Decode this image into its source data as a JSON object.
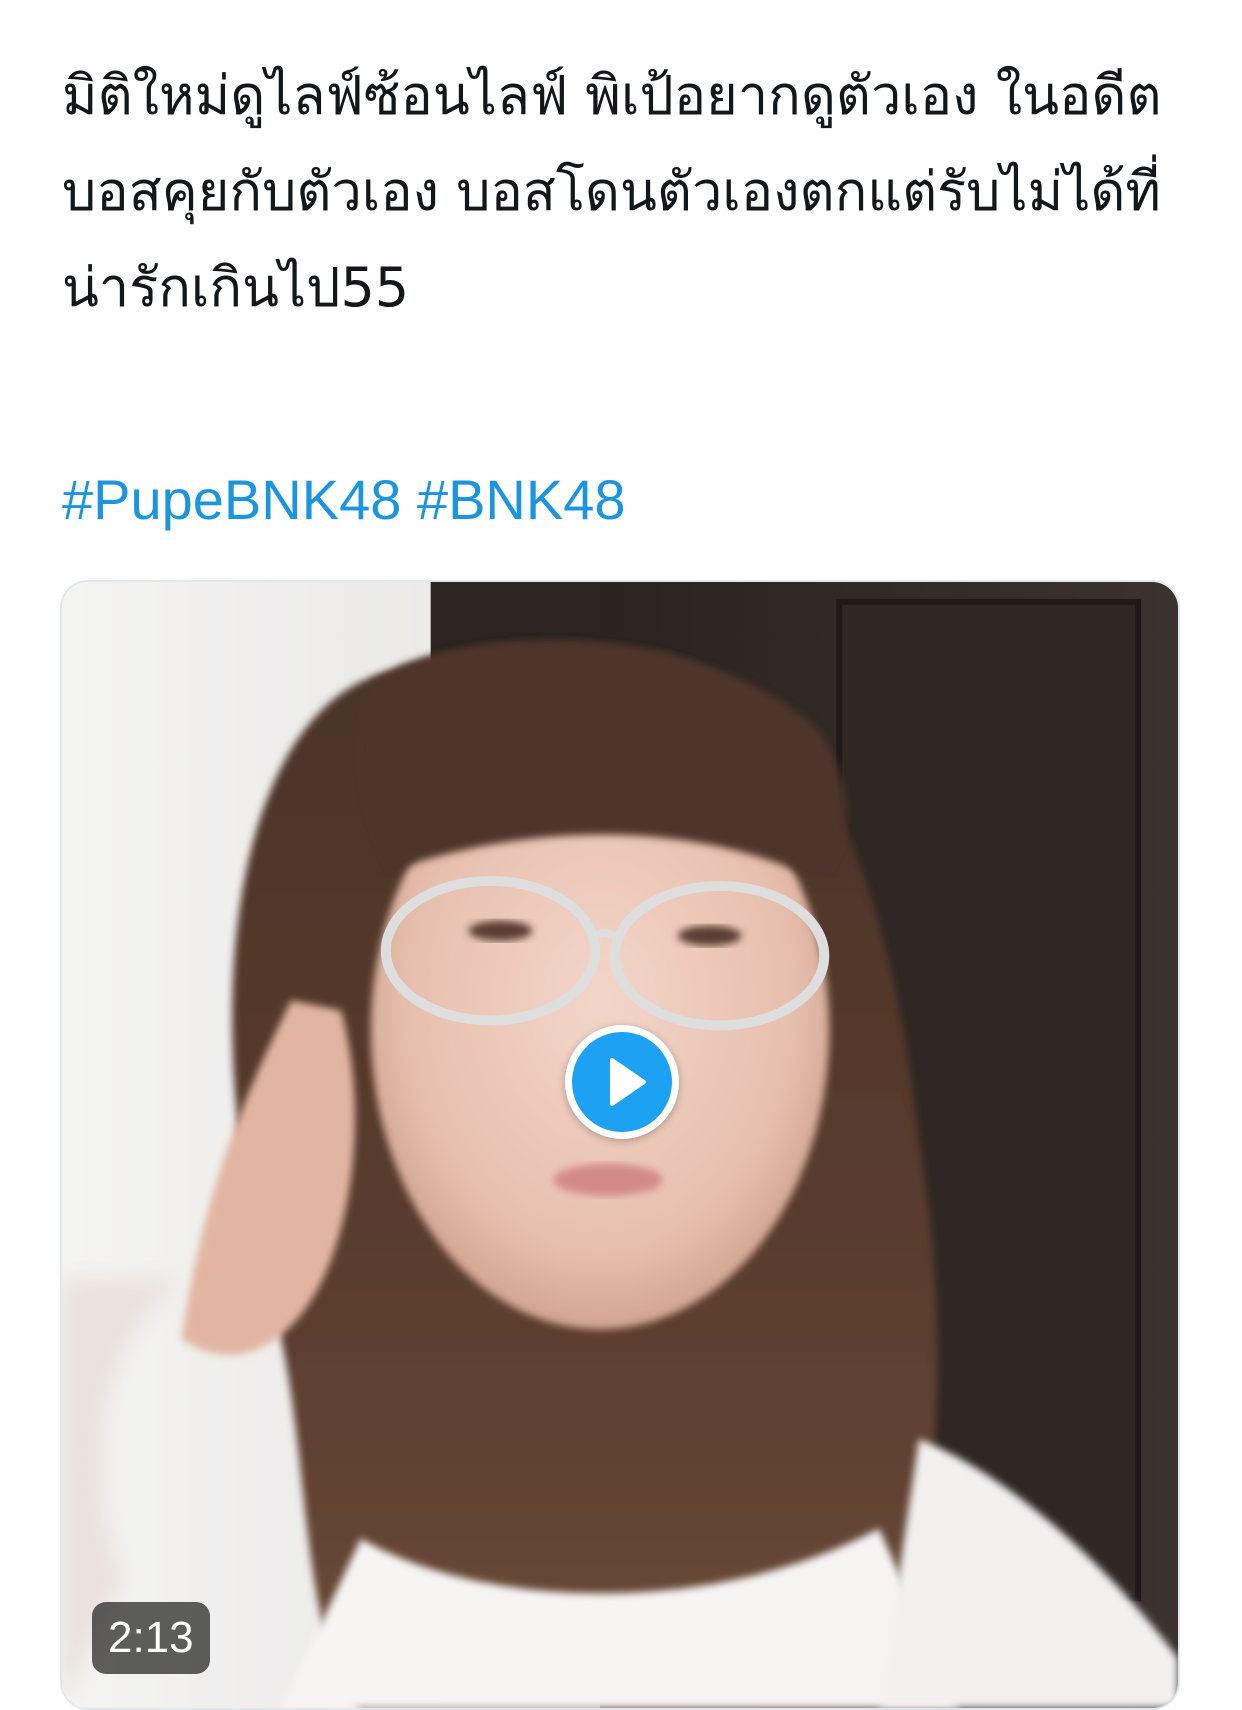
{
  "tweet": {
    "text": "มิติใหม่ดูไลฟ์ซ้อนไลฟ์ พิเป้อยากดูตัวเอง ในอดีต บอสคุยกับตัวเอง บอสโดนตัวเองตกแต่รับไม่ได้ที่น่ารักเกินไป55",
    "hashtags": [
      "#PupeBNK48",
      "#BNK48"
    ]
  },
  "media": {
    "duration": "2:13",
    "play_icon": "play-icon"
  },
  "colors": {
    "text": "#14171a",
    "hashtag": "#1b95e0",
    "play_button": "#1da1f2"
  }
}
